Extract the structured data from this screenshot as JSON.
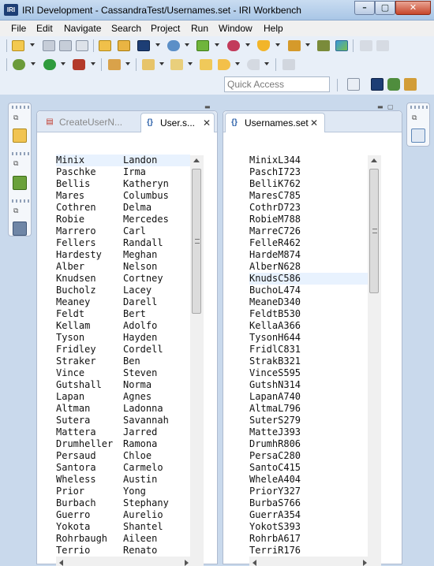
{
  "window": {
    "logo_text": "IRI",
    "title": "IRI Development - CassandraTest/Usernames.set - IRI Workbench",
    "minimize": "–",
    "maximize": "▢",
    "close": "✕"
  },
  "menu": {
    "items": [
      "File",
      "Edit",
      "Navigate",
      "Search",
      "Project",
      "Run",
      "Window",
      "Help"
    ]
  },
  "toolbar": {
    "row1_icons": [
      "new-icon",
      "save-icon",
      "save-all-icon",
      "print-icon",
      "open-folder-icon",
      "import-icon",
      "iri-icon",
      "run-job-icon",
      "palette-icon",
      "shield-icon",
      "wand-icon",
      "tools-icon",
      "image-icon",
      "undo-icon",
      "redo-icon"
    ],
    "row2_icons": [
      "debug-icon",
      "run-icon",
      "external-tools-icon",
      "pen-icon",
      "annotation-icon",
      "next-annotation-icon",
      "prev-annotation-icon",
      "back-icon",
      "forward-icon",
      "pin-icon"
    ]
  },
  "quick_access": {
    "placeholder": "Quick Access"
  },
  "left_editor": {
    "tabs": [
      {
        "label": "CreateUserN...",
        "active": false
      },
      {
        "label": "User.s...",
        "active": true,
        "close": "✕"
      }
    ],
    "rows": [
      [
        "Minix",
        "Landon"
      ],
      [
        "Paschke",
        "Irma"
      ],
      [
        "Bellis",
        "Katheryn"
      ],
      [
        "Mares",
        "Columbus"
      ],
      [
        "Cothren",
        "Delma"
      ],
      [
        "Robie",
        "Mercedes"
      ],
      [
        "Marrero",
        "Carl"
      ],
      [
        "Fellers",
        "Randall"
      ],
      [
        "Hardesty",
        "Meghan"
      ],
      [
        "Alber",
        "Nelson"
      ],
      [
        "Knudsen",
        "Cortney"
      ],
      [
        "Bucholz",
        "Lacey"
      ],
      [
        "Meaney",
        "Darell"
      ],
      [
        "Feldt",
        "Bert"
      ],
      [
        "Kellam",
        "Adolfo"
      ],
      [
        "Tyson",
        "Hayden"
      ],
      [
        "Fridley",
        "Cordell"
      ],
      [
        "Straker",
        "Ben"
      ],
      [
        "Vince",
        "Steven"
      ],
      [
        "Gutshall",
        "Norma"
      ],
      [
        "Lapan",
        "Agnes"
      ],
      [
        "Altman",
        "Ladonna"
      ],
      [
        "Sutera",
        "Savannah"
      ],
      [
        "Mattera",
        "Jarred"
      ],
      [
        "Drumheller",
        "Ramona"
      ],
      [
        "Persaud",
        "Chloe"
      ],
      [
        "Santora",
        "Carmelo"
      ],
      [
        "Wheless",
        "Austin"
      ],
      [
        "Prior",
        "Yong"
      ],
      [
        "Burbach",
        "Stephany"
      ],
      [
        "Guerro",
        "Aurelio"
      ],
      [
        "Yokota",
        "Shantel"
      ],
      [
        "Rohrbaugh",
        "Aileen"
      ],
      [
        "Terrio",
        "Renato"
      ]
    ]
  },
  "right_editor": {
    "tab": {
      "label": "Usernames.set",
      "close": "✕"
    },
    "rows": [
      "MinixL344",
      "PaschI723",
      "BelliK762",
      "MaresC785",
      "CothrD723",
      "RobieM788",
      "MarreC726",
      "FelleR462",
      "HardeM874",
      "AlberN628",
      "KnudsC586",
      "BuchoL474",
      "MeaneD340",
      "FeldtB530",
      "KellaA366",
      "TysonH644",
      "FridlC831",
      "StrakB321",
      "VinceS595",
      "GutshN314",
      "LapanA740",
      "AltmaL796",
      "SuterS279",
      "MatteJ393",
      "DrumhR806",
      "PersaC280",
      "SantoC415",
      "WheleA404",
      "PriorY327",
      "BurbaS766",
      "GuerrA354",
      "YokotS393",
      "RohrbA617",
      "TerriR176"
    ]
  },
  "colors": {
    "workbench_bg": "#c9d9ec",
    "current_line": "#e8f2fe",
    "title_gradient_top": "#c9dcf1"
  }
}
